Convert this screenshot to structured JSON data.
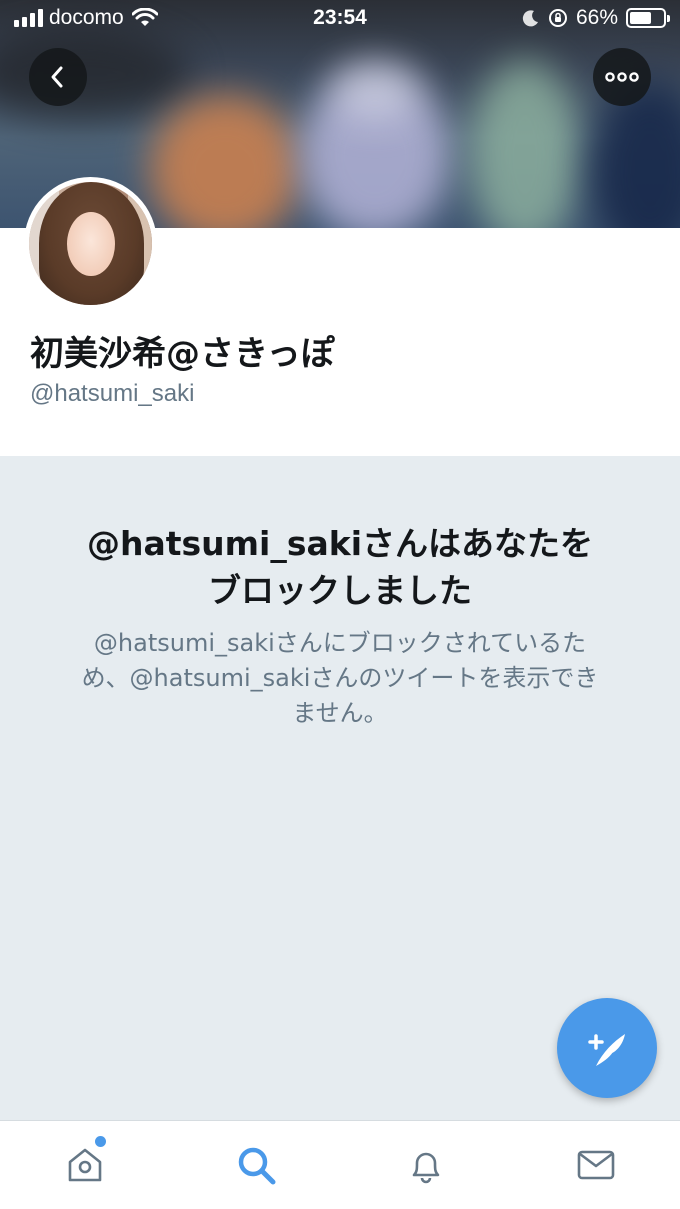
{
  "status_bar": {
    "carrier": "docomo",
    "time": "23:54",
    "battery": "66%",
    "battery_level": 0.66
  },
  "header": {
    "back_icon": "chevron-left-icon",
    "more_icon": "more-horizontal-icon"
  },
  "profile": {
    "display_name": "初美沙希@さきっぽ",
    "handle": "@hatsumi_saki"
  },
  "blocked": {
    "title_line1": "@hatsumi_sakiさんはあなたを",
    "title_line2": "ブロックしました",
    "desc_line1": "@hatsumi_sakiさんにブロックされているた",
    "desc_line2": "め、@hatsumi_sakiさんのツイートを表示でき",
    "desc_line3": "ません。"
  },
  "fab": {
    "icon": "compose-tweet-icon"
  },
  "tabbar": {
    "items": [
      {
        "name": "home",
        "icon": "home-icon",
        "has_badge": true
      },
      {
        "name": "search",
        "icon": "search-icon",
        "active": true
      },
      {
        "name": "notifications",
        "icon": "bell-icon"
      },
      {
        "name": "messages",
        "icon": "mail-icon"
      }
    ]
  },
  "colors": {
    "accent": "#4a99e9",
    "background": "#e6ecf0",
    "secondary_text": "#657786"
  }
}
